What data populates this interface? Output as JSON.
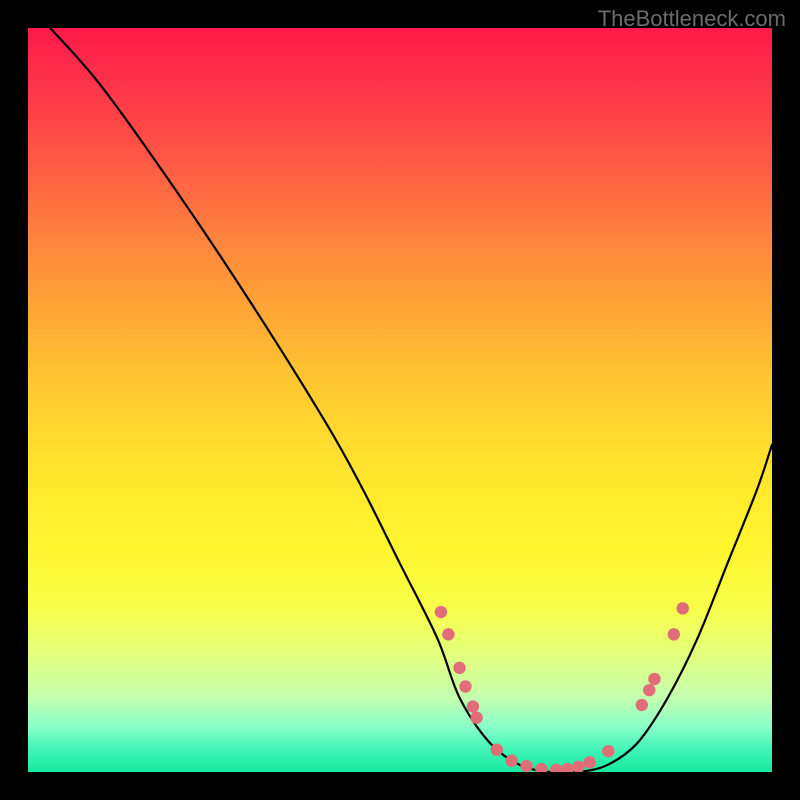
{
  "watermark": "TheBottleneck.com",
  "chart_data": {
    "type": "line",
    "title": "",
    "xlabel": "",
    "ylabel": "",
    "xlim": [
      0,
      100
    ],
    "ylim": [
      0,
      100
    ],
    "series": [
      {
        "name": "curve",
        "x": [
          3,
          10,
          20,
          30,
          40,
          45,
          50,
          55,
          58,
          62,
          66,
          70,
          74,
          78,
          82,
          86,
          90,
          94,
          98,
          100
        ],
        "y": [
          100,
          92,
          78,
          63,
          47,
          38,
          28,
          18,
          10,
          4,
          1,
          0,
          0,
          1,
          4,
          10,
          18,
          28,
          38,
          44
        ]
      }
    ],
    "markers": [
      {
        "x": 55.5,
        "y": 21.5
      },
      {
        "x": 56.5,
        "y": 18.5
      },
      {
        "x": 58.0,
        "y": 14.0
      },
      {
        "x": 58.8,
        "y": 11.5
      },
      {
        "x": 59.8,
        "y": 8.8
      },
      {
        "x": 60.3,
        "y": 7.3
      },
      {
        "x": 63.0,
        "y": 3.0
      },
      {
        "x": 65.0,
        "y": 1.5
      },
      {
        "x": 67.0,
        "y": 0.8
      },
      {
        "x": 69.0,
        "y": 0.4
      },
      {
        "x": 71.0,
        "y": 0.3
      },
      {
        "x": 72.5,
        "y": 0.4
      },
      {
        "x": 74.0,
        "y": 0.7
      },
      {
        "x": 75.5,
        "y": 1.3
      },
      {
        "x": 78.0,
        "y": 2.8
      },
      {
        "x": 82.5,
        "y": 9.0
      },
      {
        "x": 83.5,
        "y": 11.0
      },
      {
        "x": 84.2,
        "y": 12.5
      },
      {
        "x": 86.8,
        "y": 18.5
      },
      {
        "x": 88.0,
        "y": 22.0
      }
    ],
    "marker_color": "#e06d78",
    "curve_color": "#000000"
  }
}
